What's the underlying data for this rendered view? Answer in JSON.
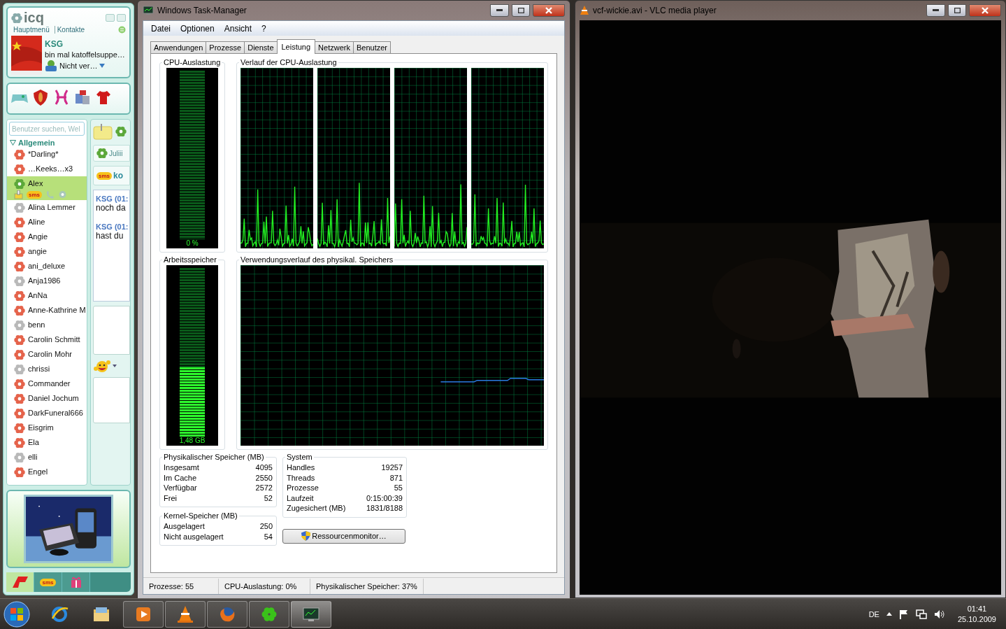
{
  "icq": {
    "title": "icq",
    "nav": [
      "Hauptmenü",
      "Kontakte"
    ],
    "profile": {
      "name": "KSG",
      "status_message": "bin mal katoffelsuppe…",
      "status": "Nicht ver…"
    },
    "search": {
      "placeholder": "Benutzer suchen, Wel"
    },
    "group": {
      "label": "Allgemein",
      "expanded": true
    },
    "contacts": [
      {
        "name": "*Darling*",
        "color": "#e5634b",
        "selected": false
      },
      {
        "name": "…Keeks…x3",
        "color": "#e5634b",
        "selected": false
      },
      {
        "name": "Alex",
        "color": "#5ca83a",
        "selected": true,
        "sms_label": "sms"
      },
      {
        "name": "Alina Lemmer",
        "color": "#b9b9b9",
        "selected": false
      },
      {
        "name": "Aline",
        "color": "#e5634b",
        "selected": false
      },
      {
        "name": "Angie",
        "color": "#e5634b",
        "selected": false
      },
      {
        "name": "angie",
        "color": "#e5634b",
        "selected": false
      },
      {
        "name": "ani_deluxe",
        "color": "#e5634b",
        "selected": false
      },
      {
        "name": "Anja1986",
        "color": "#b9b9b9",
        "selected": false
      },
      {
        "name": "AnNa",
        "color": "#e5634b",
        "selected": false
      },
      {
        "name": "Anne-Kathrine M",
        "color": "#e5634b",
        "selected": false
      },
      {
        "name": "benn",
        "color": "#b9b9b9",
        "selected": false
      },
      {
        "name": "Carolin Schmitt",
        "color": "#e5634b",
        "selected": false
      },
      {
        "name": "Carolin Mohr",
        "color": "#e5634b",
        "selected": false
      },
      {
        "name": "chrissi",
        "color": "#b9b9b9",
        "selected": false
      },
      {
        "name": "Commander",
        "color": "#e5634b",
        "selected": false
      },
      {
        "name": "Daniel Jochum",
        "color": "#e5634b",
        "selected": false
      },
      {
        "name": "DarkFuneral666",
        "color": "#e5634b",
        "selected": false
      },
      {
        "name": "Eisgrim",
        "color": "#e5634b",
        "selected": false
      },
      {
        "name": "Ela",
        "color": "#e5634b",
        "selected": false
      },
      {
        "name": "elli",
        "color": "#b9b9b9",
        "selected": false
      },
      {
        "name": "Engel",
        "color": "#e5634b",
        "selected": false
      }
    ],
    "chat": {
      "contact": "Juliii",
      "sms_label": "sms",
      "sms_text": "ko",
      "messages": [
        {
          "sender": "KSG (01:",
          "text": "noch da"
        },
        {
          "sender": "KSG (01:",
          "text": "hast du"
        }
      ]
    },
    "bottom_tabs": [
      {
        "kind": "logo"
      },
      {
        "kind": "sms",
        "label": "sms"
      },
      {
        "kind": "gift"
      }
    ]
  },
  "task_manager": {
    "title": "Windows Task-Manager",
    "menu": [
      "Datei",
      "Optionen",
      "Ansicht",
      "?"
    ],
    "tabs": [
      {
        "label": "Anwendungen",
        "selected": false
      },
      {
        "label": "Prozesse",
        "selected": false
      },
      {
        "label": "Dienste",
        "selected": false
      },
      {
        "label": "Leistung",
        "selected": true
      },
      {
        "label": "Netzwerk",
        "selected": false
      },
      {
        "label": "Benutzer",
        "selected": false
      }
    ],
    "cpu": {
      "title": "CPU-Auslastung",
      "reading": "0 %"
    },
    "cpu_history": {
      "title": "Verlauf der CPU-Auslastung"
    },
    "memory": {
      "title": "Arbeitsspeicher",
      "level": 0.41,
      "reading": "1,48 GB"
    },
    "memory_history": {
      "title": "Verwendungsverlauf des physikal. Speichers"
    },
    "physical_memory": {
      "title": "Physikalischer Speicher (MB)",
      "rows": [
        {
          "label": "Insgesamt",
          "value": "4095"
        },
        {
          "label": "Im Cache",
          "value": "2550"
        },
        {
          "label": "Verfügbar",
          "value": "2572"
        },
        {
          "label": "Frei",
          "value": "52"
        }
      ]
    },
    "kernel_memory": {
      "title": "Kernel-Speicher (MB)",
      "rows": [
        {
          "label": "Ausgelagert",
          "value": "250"
        },
        {
          "label": "Nicht ausgelagert",
          "value": "54"
        }
      ]
    },
    "system": {
      "title": "System",
      "rows": [
        {
          "label": "Handles",
          "value": "19257"
        },
        {
          "label": "Threads",
          "value": "871"
        },
        {
          "label": "Prozesse",
          "value": "55"
        },
        {
          "label": "Laufzeit",
          "value": "0:15:00:39"
        },
        {
          "label": "Zugesichert (MB)",
          "value": "1831/8188"
        }
      ]
    },
    "resource_button": "Ressourcenmonitor…",
    "status_bar": [
      "Prozesse: 55",
      "CPU-Auslastung: 0%",
      "Physikalischer Speicher: 37%"
    ]
  },
  "vlc": {
    "title": "vcf-wickie.avi - VLC media player"
  },
  "taskbar": {
    "buttons": [
      {
        "kind": "browser",
        "running": false,
        "selected": false
      },
      {
        "kind": "folder",
        "running": false,
        "selected": false
      },
      {
        "kind": "media_player",
        "running": true,
        "selected": false
      },
      {
        "kind": "cone",
        "running": true,
        "selected": false
      },
      {
        "kind": "fox",
        "running": true,
        "selected": false
      },
      {
        "kind": "flower",
        "running": true,
        "selected": false
      },
      {
        "kind": "monitor",
        "running": true,
        "selected": true
      }
    ],
    "language": "DE",
    "time": "01:41",
    "date": "25.10.2009"
  }
}
